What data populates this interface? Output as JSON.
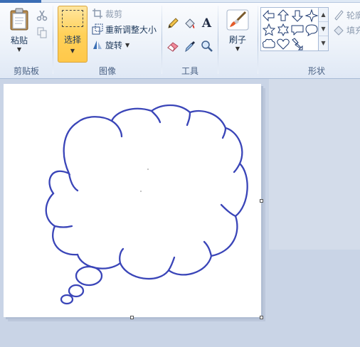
{
  "ribbon": {
    "clipboard": {
      "paste_label": "粘贴",
      "group_label": "剪贴板"
    },
    "image": {
      "select_label": "选择",
      "crop_label": "裁剪",
      "resize_label": "重新调整大小",
      "rotate_label": "旋转",
      "group_label": "图像"
    },
    "tools": {
      "group_label": "工具"
    },
    "brushes": {
      "label": "刷子"
    },
    "shapes": {
      "outline_label": "轮廓",
      "fill_label": "填充",
      "group_label": "形状"
    }
  },
  "colors": {
    "shape_stroke": "#3a45b8",
    "select_active": "#ffd159",
    "canvas": "#ffffff",
    "workspace": "#c9d4e6"
  },
  "icons": {
    "paste": "clipboard-icon",
    "cut": "scissors-icon",
    "copy": "copy-icon",
    "crop": "crop-icon",
    "resize": "resize-icon",
    "rotate": "rotate-icon",
    "pencil": "pencil-icon",
    "fill": "bucket-icon",
    "text": "text-icon",
    "eraser": "eraser-icon",
    "picker": "color-picker-icon",
    "magnifier": "magnifier-icon",
    "brush": "brush-icon"
  }
}
